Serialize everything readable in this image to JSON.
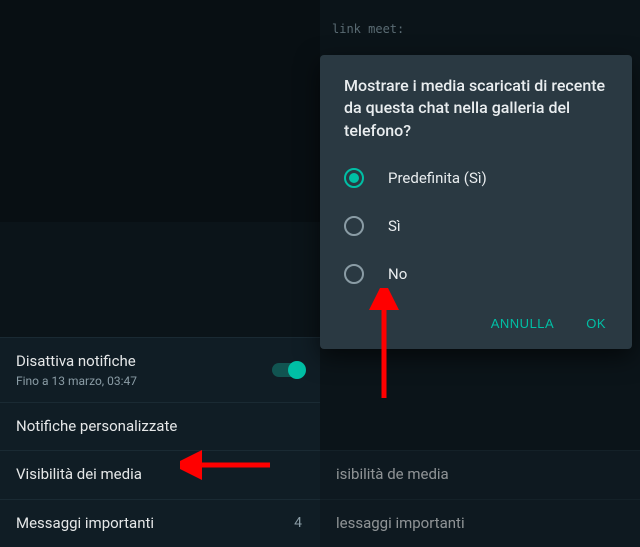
{
  "leftList": {
    "muteTitle": "Disattiva notifiche",
    "muteSubtitle": "Fino a 13 marzo, 03:47",
    "customNotifications": "Notifiche personalizzate",
    "mediaVisibility": "Visibilità dei media",
    "importantMessages": "Messaggi importanti",
    "importantCount": "4"
  },
  "rightList": {
    "mediaVisibility": "isibilità de",
    "mediaVisibilitySuffix": "media",
    "importantMessages": "lessaggi importanti"
  },
  "dialog": {
    "title": "Mostrare i media scaricati di recente da questa chat nella galleria del telefono?",
    "options": {
      "default": "Predefinita (Sì)",
      "yes": "Sì",
      "no": "No"
    },
    "cancel": "ANNULLA",
    "ok": "OK"
  },
  "faintLink": "link meet:"
}
